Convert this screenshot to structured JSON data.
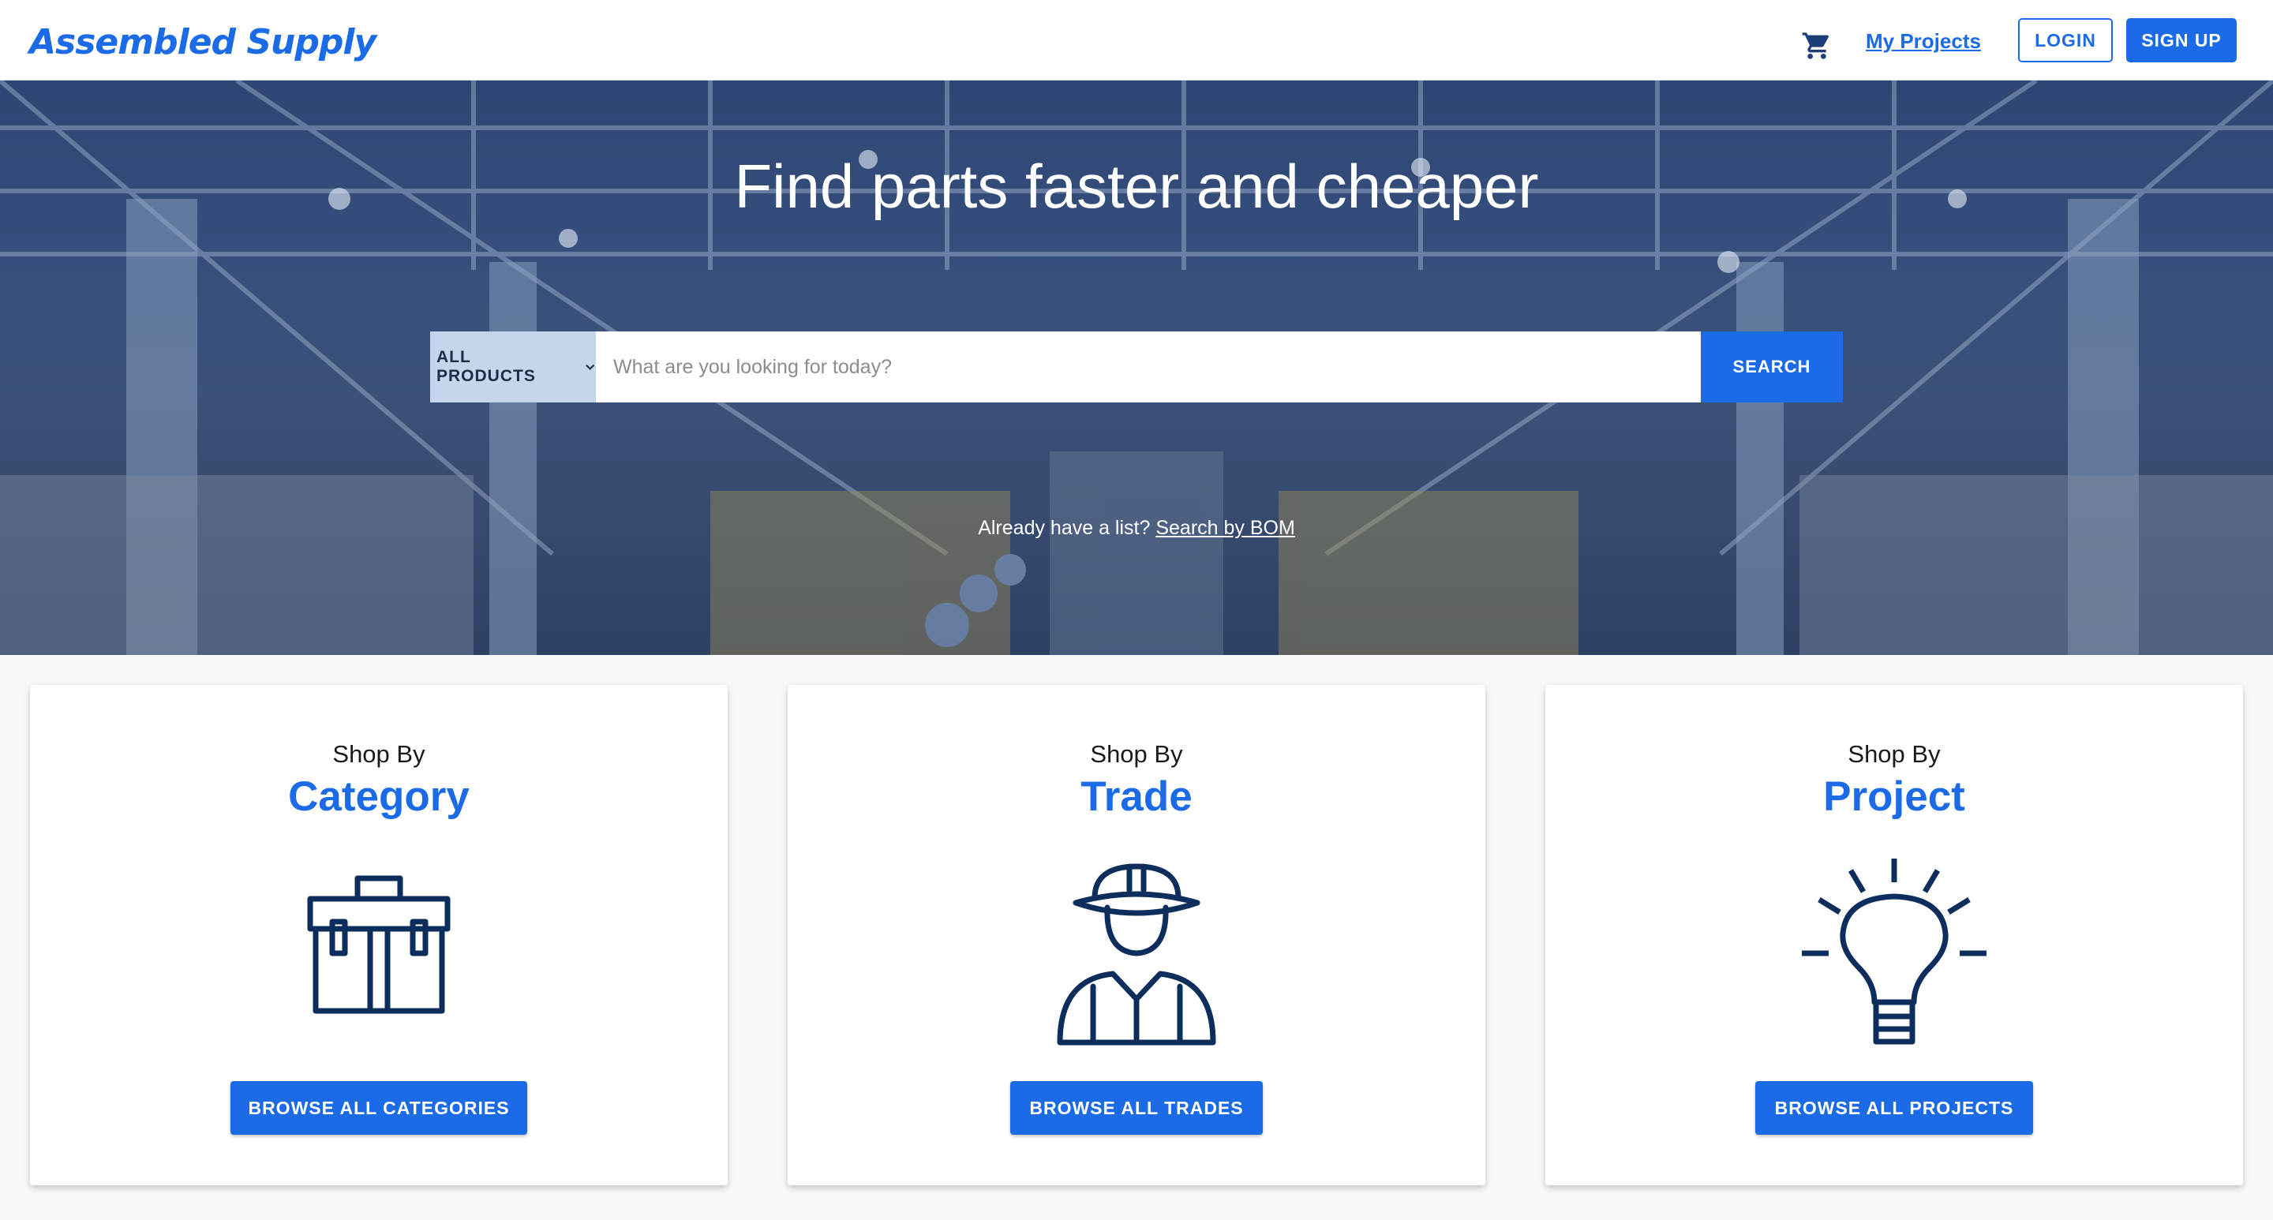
{
  "header": {
    "logo": "Assembled Supply",
    "cart_icon": "cart-icon",
    "my_projects": "My Projects",
    "login": "LOGIN",
    "signup": "SIGN UP"
  },
  "hero": {
    "title": "Find parts faster and cheaper",
    "category_select": {
      "selected": "ALL PRODUCTS",
      "icon": "chevron-down-icon"
    },
    "search": {
      "value": "",
      "placeholder": "What are you looking for today?"
    },
    "search_button": "SEARCH",
    "bom_prompt": "Already have a list?",
    "bom_link": "Search by BOM"
  },
  "cards": [
    {
      "small": "Shop By",
      "big": "Category",
      "icon": "toolbox-icon",
      "button": "BROWSE ALL CATEGORIES"
    },
    {
      "small": "Shop By",
      "big": "Trade",
      "icon": "worker-icon",
      "button": "BROWSE ALL TRADES"
    },
    {
      "small": "Shop By",
      "big": "Project",
      "icon": "lightbulb-icon",
      "button": "BROWSE ALL PROJECTS"
    }
  ],
  "colors": {
    "accent": "#1c6be6",
    "icon_navy": "#0d2d5c",
    "select_bg": "#c4d5ec"
  }
}
